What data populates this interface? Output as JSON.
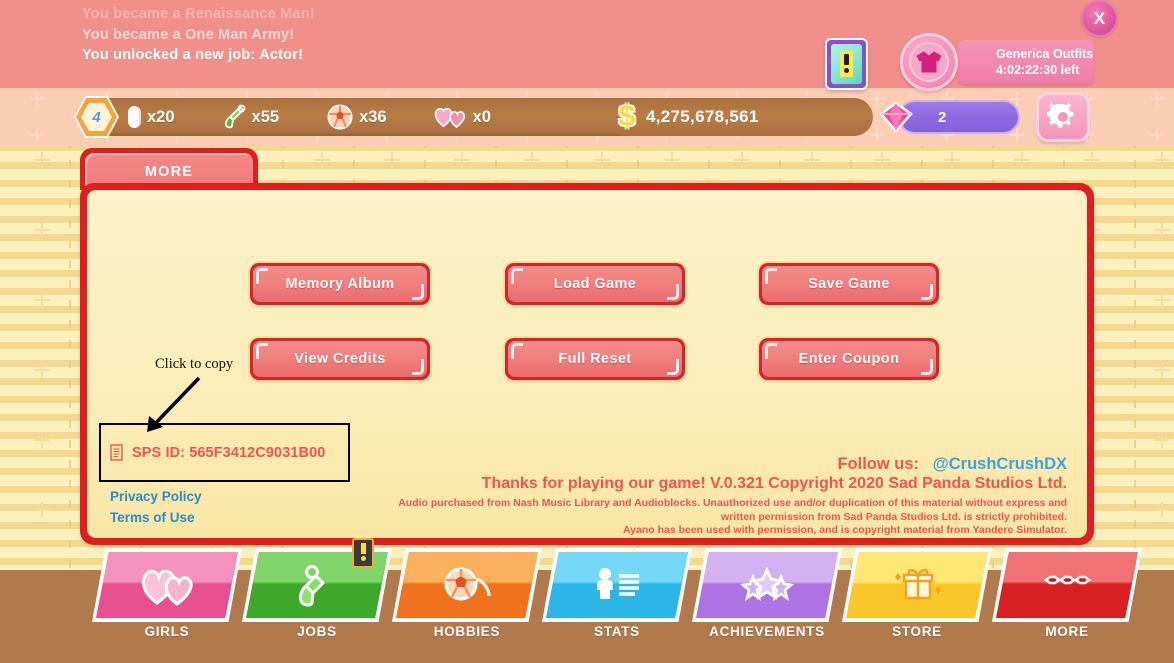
{
  "notifications": [
    "You became a Renaissance Man!",
    "You became a One Man Army!",
    "You unlocked a new job: Actor!"
  ],
  "header": {
    "close_label": "X",
    "close_icon": "close-icon",
    "notification_card_icon": "exclamation-card-icon",
    "outfits": {
      "title": "Generica Outfits",
      "timer": "4:02:22:30 left",
      "icon": "shirt-icon"
    }
  },
  "currency": {
    "clock": {
      "icon": "clock-icon",
      "value": "4"
    },
    "items": [
      {
        "icon": "pill-icon",
        "label": "x20"
      },
      {
        "icon": "shovel-icon",
        "label": "x55"
      },
      {
        "icon": "ball-icon",
        "label": "x36"
      },
      {
        "icon": "hearts-icon",
        "label": "x0"
      }
    ],
    "money": {
      "icon": "dollar-icon",
      "value": "4,275,678,561"
    },
    "gems": {
      "icon": "gem-icon",
      "value": "2"
    },
    "settings_icon": "gear-icon"
  },
  "tab": {
    "label": "MORE"
  },
  "panel": {
    "buttons": [
      {
        "label": "Memory Album"
      },
      {
        "label": "Load Game"
      },
      {
        "label": "Save Game"
      },
      {
        "label": "View Credits"
      },
      {
        "label": "Full Reset"
      },
      {
        "label": "Enter Coupon"
      }
    ],
    "click_to_copy": "Click to copy",
    "sps_id": "SPS ID: 565F3412C9031B00",
    "sps_copy_icon": "document-copy-icon",
    "privacy_policy": "Privacy Policy",
    "terms_of_use": "Terms of Use",
    "follow_us_label": "Follow us:",
    "follow_us_handle": "@CrushCrushDX",
    "thanks_line": "Thanks for playing our game!  V.0.321 Copyright 2020 Sad Panda Studios Ltd.",
    "legal_line_1": "Audio purchased from Nash Music Library and Audioblocks. Unauthorized use and/or duplication of this material without express and",
    "legal_line_2": "written permission from Sad Panda Studios Ltd. is strictly prohibited.",
    "legal_line_3": "Ayano has been used with permission, and is copyright material from Yandere Simulator."
  },
  "nav": [
    {
      "label": "GIRLS",
      "icon": "hearts-icon",
      "badge": false
    },
    {
      "label": "JOBS",
      "icon": "shovel-icon",
      "badge": true
    },
    {
      "label": "HOBBIES",
      "icon": "ball-icon",
      "badge": false
    },
    {
      "label": "STATS",
      "icon": "person-icon",
      "badge": false
    },
    {
      "label": "ACHIEVEMENTS",
      "icon": "stars-icon",
      "badge": false
    },
    {
      "label": "STORE",
      "icon": "gift-icon",
      "badge": false
    },
    {
      "label": "MORE",
      "icon": "ellipsis-icon",
      "badge": false
    }
  ],
  "colors": {
    "header_pink": "#f1908b",
    "panel_red": "#e01e20",
    "panel_cream": "#fbeeba",
    "brown_band": "#b07a4d",
    "link_blue": "#2b8ccb",
    "sps_red": "#f3544f",
    "money_brown": "#b97c46",
    "gem_purple": "#8e6ae2"
  }
}
